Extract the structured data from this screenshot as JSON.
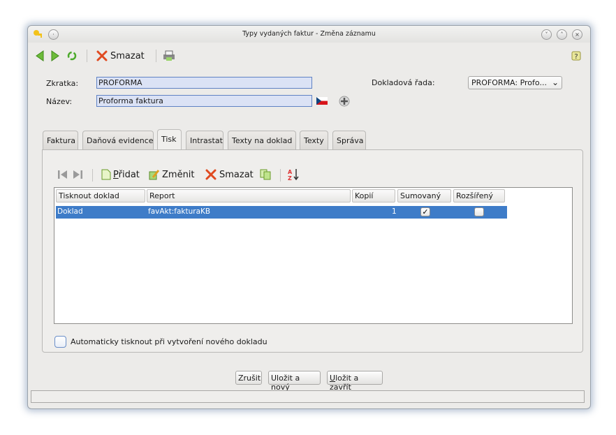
{
  "window": {
    "title": "Typy vydaných faktur - Změna záznamu"
  },
  "toolbar": {
    "delete_label": "Smazat"
  },
  "form": {
    "zkratka_label": "Zkratka:",
    "zkratka_value": "PROFORMA",
    "nazev_label": "Název:",
    "nazev_value": "Proforma faktura",
    "rada_label": "Dokladová řada:",
    "rada_value": "PROFORMA: Profo..."
  },
  "tabs": [
    {
      "label": "Faktura"
    },
    {
      "label": "Daňová evidence"
    },
    {
      "label": "Tisk"
    },
    {
      "label": "Intrastat"
    },
    {
      "label": "Texty na doklad"
    },
    {
      "label": "Texty"
    },
    {
      "label": "Správa"
    }
  ],
  "inner_toolbar": {
    "add_prefix": "P",
    "add_rest": "řidat",
    "change_label": "Změnit",
    "delete_label": "Smazat"
  },
  "table": {
    "columns": [
      "Tisknout doklad",
      "Report",
      "Kopií",
      "Sumovaný",
      "Rozšířený"
    ],
    "rows": [
      {
        "tisknout": "Doklad",
        "report": "favAkt:fakturaKB",
        "kopii": "1",
        "sumovany": true,
        "rozsireny": false
      }
    ]
  },
  "auto_print_label": "Automaticky tisknout při vytvoření nového dokladu",
  "buttons": {
    "cancel": "Zrušit",
    "save_new_a": "Uložit a ",
    "save_new_u": "n",
    "save_new_b": "ový",
    "save_close_u": "U",
    "save_close_rest": "ložit a zavřít"
  },
  "colors": {
    "selection": "#3e7cc8",
    "input_bg": "#dbe2f5",
    "window_bg": "#ecebe9"
  }
}
